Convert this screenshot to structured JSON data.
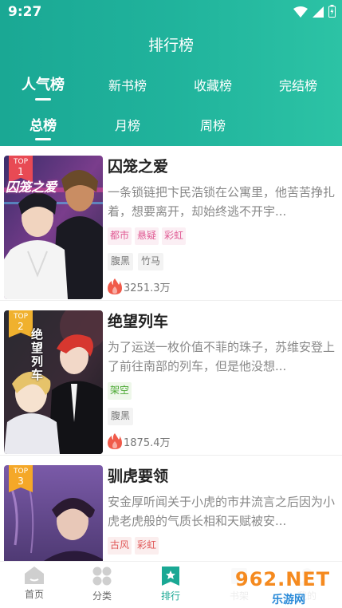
{
  "status": {
    "time": "9:27"
  },
  "header": {
    "title": "排行榜",
    "primary_tabs": [
      {
        "label": "人气榜",
        "active": true
      },
      {
        "label": "新书榜"
      },
      {
        "label": "收藏榜"
      },
      {
        "label": "完结榜"
      }
    ],
    "secondary_tabs": [
      {
        "label": "总榜",
        "active": true
      },
      {
        "label": "月榜"
      },
      {
        "label": "周榜"
      }
    ]
  },
  "items": [
    {
      "rank_prefix": "TOP",
      "rank": "1",
      "cover_text": "囚笼之爱",
      "title": "囚笼之爱",
      "desc": "一条锁链把卞民浩锁在公寓里，他苦苦挣扎着，想要离开，却始终逃不开宇...",
      "tags": [
        "都市",
        "悬疑",
        "彩虹"
      ],
      "tags2": [
        "腹黑",
        "竹马"
      ],
      "hot": "3251.3万"
    },
    {
      "rank_prefix": "TOP",
      "rank": "2",
      "cover_text": "绝望列车",
      "title": "绝望列车",
      "desc": "为了运送一枚价值不菲的珠子，苏维安登上了前往南部的列车，但是他没想...",
      "tags": [
        "架空"
      ],
      "tags2": [
        "腹黑"
      ],
      "hot": "1875.4万"
    },
    {
      "rank_prefix": "TOP",
      "rank": "3",
      "title": "驯虎要领",
      "desc": "安金厚听闻关于小虎的市井流言之后因为小虎老虎般的气质长相和天赋被安...",
      "tags": [
        "古风",
        "彩虹"
      ]
    }
  ],
  "bottom_nav": [
    {
      "label": "首页",
      "icon": "home-icon"
    },
    {
      "label": "分类",
      "icon": "category-icon"
    },
    {
      "label": "排行",
      "icon": "ranking-icon",
      "active": true
    },
    {
      "label": "书架",
      "icon": "bookshelf-icon"
    },
    {
      "label": "我的",
      "icon": "profile-icon"
    }
  ],
  "watermark": {
    "text": "962.NET",
    "sub": "乐游网"
  },
  "colors": {
    "accent": "#1aa894",
    "accent_light": "#2cc3a5",
    "hot": "#f05a4a"
  }
}
